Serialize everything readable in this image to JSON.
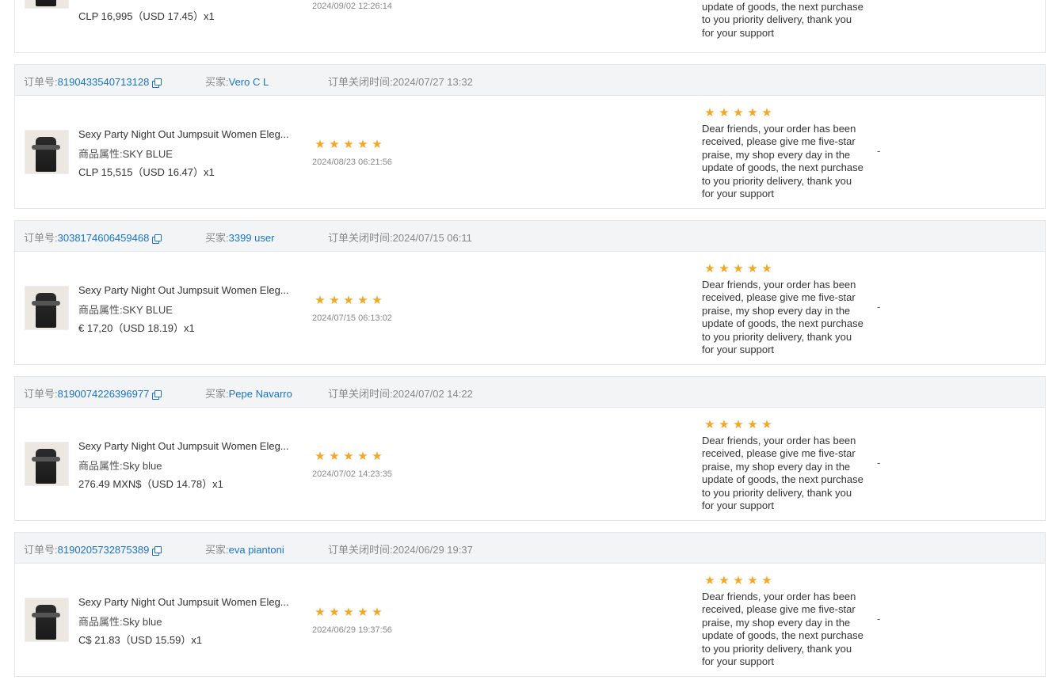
{
  "labels": {
    "order_no": "订单号:",
    "buyer": "买家:",
    "closed": "订单关闭时间:",
    "attr": "商品属性:",
    "dash": "-"
  },
  "top_card": {
    "price": "CLP 16,995（USD  17.45）x1",
    "review_date": "2024/09/02 12:26:14",
    "reply_tail": "praise, my shop every day in the update of goods, the next purchase to you priority delivery, thank you for your support"
  },
  "orders": [
    {
      "order_no": "8190433540713128",
      "buyer": "Vero C L",
      "closed_time": "2024/07/27 13:32",
      "product_name": "Sexy Party Night Out Jumpsuit Women Eleg...",
      "attribute": "SKY BLUE",
      "price": "CLP 15,515（USD  16.47）x1",
      "rating": 5,
      "review_date": "2024/08/23 06:21:56",
      "seller_rating": 5,
      "reply": "Dear friends, your order has been received, please give me five-star praise, my shop every day in the update of goods, the next purchase to you priority delivery, thank you for your support"
    },
    {
      "order_no": "3038174606459468",
      "buyer": "3399 user",
      "closed_time": "2024/07/15 06:11",
      "product_name": "Sexy Party Night Out Jumpsuit Women Eleg...",
      "attribute": "SKY BLUE",
      "price": "€ 17,20（USD  18.19）x1",
      "rating": 5,
      "review_date": "2024/07/15 06:13:02",
      "seller_rating": 5,
      "reply": "Dear friends, your order has been received, please give me five-star praise, my shop every day in the update of goods, the next purchase to you priority delivery, thank you for your support"
    },
    {
      "order_no": "8190074226396977",
      "buyer": "Pepe Navarro",
      "closed_time": "2024/07/02 14:22",
      "product_name": "Sexy Party Night Out Jumpsuit Women Eleg...",
      "attribute": "Sky blue",
      "price": "276.49 MXN$（USD  14.78）x1",
      "rating": 5,
      "review_date": "2024/07/02 14:23:35",
      "seller_rating": 5,
      "reply": "Dear friends, your order has been received, please give me five-star praise, my shop every day in the update of goods, the next purchase to you priority delivery, thank you for your support"
    },
    {
      "order_no": "8190205732875389",
      "buyer": "eva piantoni",
      "closed_time": "2024/06/29 19:37",
      "product_name": "Sexy Party Night Out Jumpsuit Women Eleg...",
      "attribute": "Sky blue",
      "price": "C$ 21.83（USD  15.59）x1",
      "rating": 5,
      "review_date": "2024/06/29 19:37:56",
      "seller_rating": 5,
      "reply": "Dear friends, your order has been received, please give me five-star praise, my shop every day in the update of goods, the next purchase to you priority delivery, thank you for your support"
    }
  ],
  "colors": {
    "link": "#1a73c8",
    "star": "#f5a623",
    "header_bg": "#f2f4f6"
  }
}
